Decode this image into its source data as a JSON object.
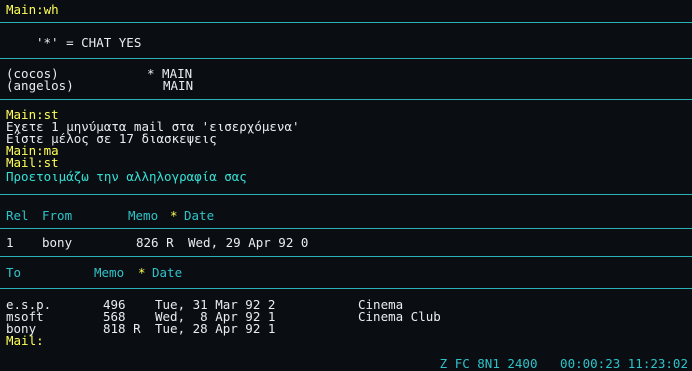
{
  "lines": {
    "cmd_wh": "Main:wh",
    "chat_header": "'*' = CHAT YES",
    "user1_name": "(cocos)",
    "user1_status": "* MAIN",
    "user2_name": "(angelos)",
    "user2_status": "MAIN",
    "cmd_st": "Main:st",
    "msg1": "Εχετε 1 μηνύματα mail στα 'εισερχόμενα'",
    "msg2": "Είστε μέλος σε 17 διασκεψεις",
    "cmd_ma": "Main:ma",
    "cmd_mail_st": "Mail:st",
    "prep_msg": "Προετοιμάζω την αλληλογραφία σας"
  },
  "inbox": {
    "headers": {
      "rel": "Rel",
      "from": "From",
      "memo": "Memo",
      "star": "*",
      "date": "Date"
    },
    "rows": [
      {
        "rel": "1",
        "from": "bony",
        "memo": "826 R",
        "date": "Wed, 29 Apr 92 0"
      }
    ]
  },
  "outbox": {
    "headers": {
      "to": "To",
      "memo": "Memo",
      "star": "*",
      "date": "Date"
    },
    "rows": [
      {
        "to": "e.s.p.",
        "memo": "496",
        "date": "Tue, 31 Mar 92 2",
        "subject": "Cinema"
      },
      {
        "to": "msoft",
        "memo": "568",
        "date": "Wed,  8 Apr 92 1",
        "subject": "Cinema Club"
      },
      {
        "to": "bony",
        "memo": "818 R",
        "date": "Tue, 28 Apr 92 1",
        "subject": ""
      }
    ]
  },
  "prompt": "Mail:",
  "status_bar": "Z FC 8N1 2400   00:00:23 11:23:02"
}
